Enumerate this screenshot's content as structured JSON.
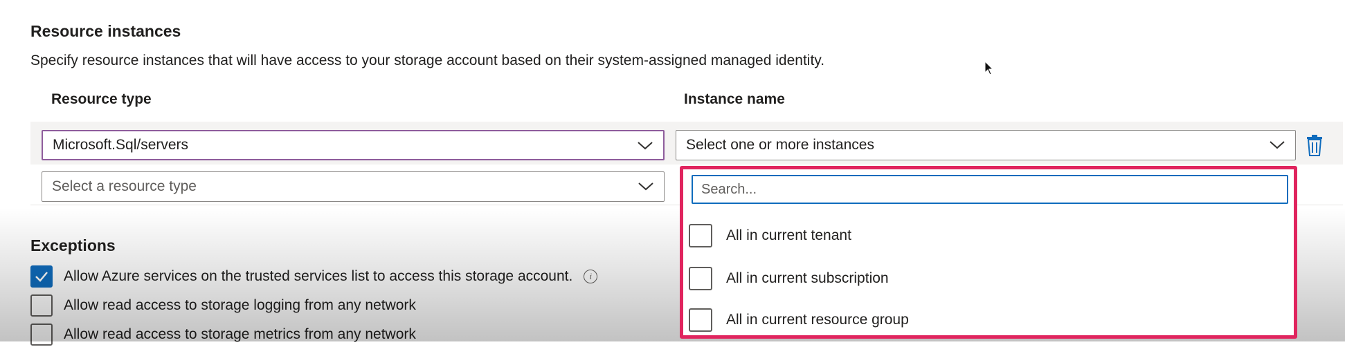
{
  "resource_instances": {
    "title": "Resource instances",
    "description": "Specify resource instances that will have access to your storage account based on their system-assigned managed identity.",
    "col_resource_type": "Resource type",
    "col_instance_name": "Instance name",
    "rows": [
      {
        "resource_type": "Microsoft.Sql/servers",
        "instance_name": "Select one or more instances"
      },
      {
        "resource_type_placeholder": "Select a resource type"
      }
    ],
    "instance_dropdown": {
      "search_placeholder": "Search...",
      "options": [
        {
          "label": "All in current tenant",
          "checked": false
        },
        {
          "label": "All in current subscription",
          "checked": false
        },
        {
          "label": "All in current resource group",
          "checked": false
        }
      ]
    }
  },
  "exceptions": {
    "title": "Exceptions",
    "items": [
      {
        "label": "Allow Azure services on the trusted services list to access this storage account.",
        "checked": true,
        "info_icon": "info-icon"
      },
      {
        "label": "Allow read access to storage logging from any network",
        "checked": false
      },
      {
        "label": "Allow read access to storage metrics from any network",
        "checked": false
      }
    ]
  },
  "colors": {
    "highlight_border": "#e0245e",
    "focus_border": "#8e5c9c",
    "accent_blue": "#0f6cbd"
  }
}
